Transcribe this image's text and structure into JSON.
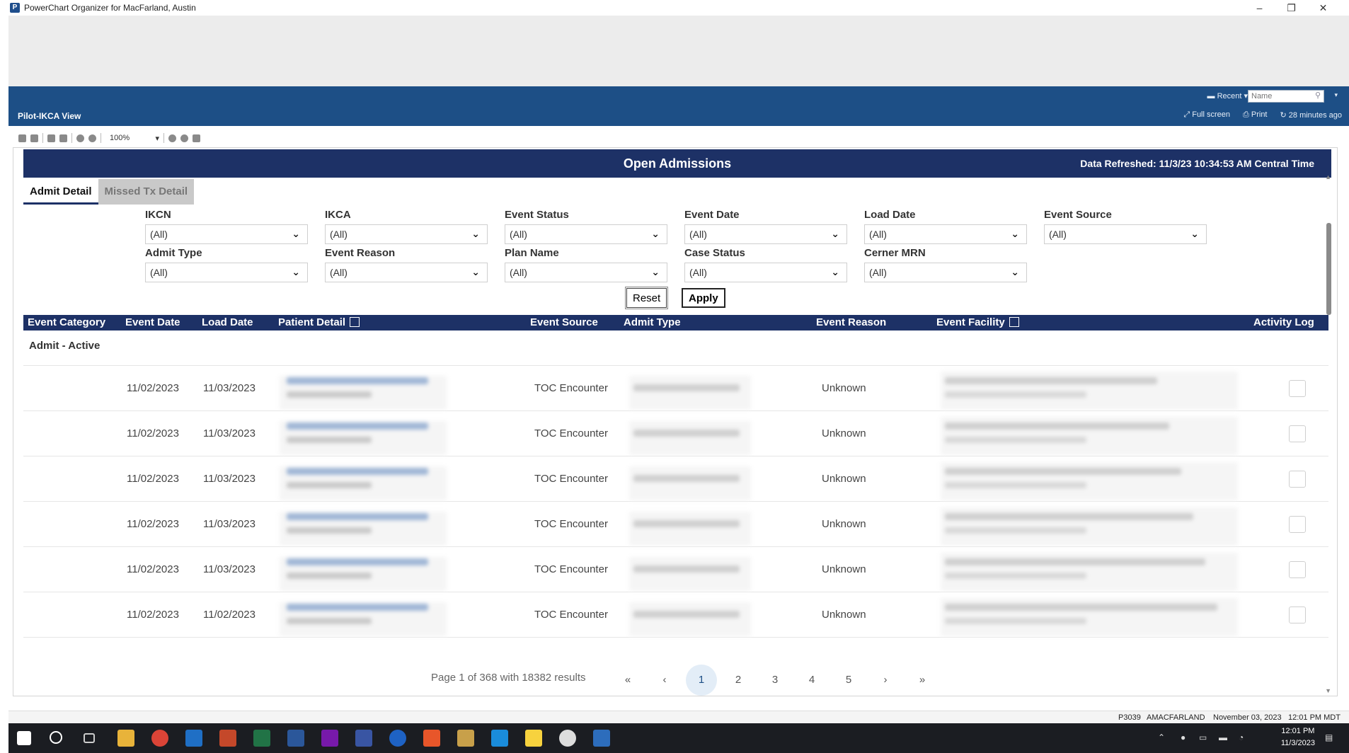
{
  "window": {
    "title": "PowerChart Organizer for MacFarland, Austin",
    "app_icon": "P",
    "controls": [
      "–",
      "❐",
      "✕"
    ]
  },
  "navbar": {
    "recent_label": "Recent",
    "name_placeholder": "Name"
  },
  "viewbar": {
    "title": "Pilot-IKCA View",
    "full_screen": "Full screen",
    "print": "Print",
    "refreshed_ago": "28 minutes ago"
  },
  "toolbar": {
    "zoom": "100%"
  },
  "header": {
    "title": "Open Admissions",
    "data_refreshed": "Data Refreshed: 11/3/23 10:34:53 AM Central Time"
  },
  "tabs": [
    {
      "label": "Admit Detail",
      "active": true
    },
    {
      "label": "Missed Tx Detail",
      "active": false
    }
  ],
  "filters": [
    {
      "label": "IKCN",
      "value": "(All)"
    },
    {
      "label": "IKCA",
      "value": "(All)"
    },
    {
      "label": "Event Status",
      "value": "(All)"
    },
    {
      "label": "Event Date",
      "value": "(All)"
    },
    {
      "label": "Load Date",
      "value": "(All)"
    },
    {
      "label": "Event Source",
      "value": "(All)"
    },
    {
      "label": "Admit Type",
      "value": "(All)"
    },
    {
      "label": "Event Reason",
      "value": "(All)"
    },
    {
      "label": "Plan Name",
      "value": "(All)"
    },
    {
      "label": "Case Status",
      "value": "(All)"
    },
    {
      "label": "Cerner MRN",
      "value": "(All)"
    }
  ],
  "buttons": {
    "reset": "Reset",
    "apply": "Apply"
  },
  "grid": {
    "columns": [
      "Event Category",
      "Event Date",
      "Load Date",
      "Patient Detail",
      "Event Source",
      "Admit Type",
      "Event Reason",
      "Event Facility",
      "Activity Log"
    ],
    "group": "Admit - Active",
    "rows": [
      {
        "event_date": "11/02/2023",
        "load_date": "11/03/2023",
        "event_source": "TOC Encounter",
        "event_reason": "Unknown"
      },
      {
        "event_date": "11/02/2023",
        "load_date": "11/03/2023",
        "event_source": "TOC Encounter",
        "event_reason": "Unknown"
      },
      {
        "event_date": "11/02/2023",
        "load_date": "11/03/2023",
        "event_source": "TOC Encounter",
        "event_reason": "Unknown"
      },
      {
        "event_date": "11/02/2023",
        "load_date": "11/03/2023",
        "event_source": "TOC Encounter",
        "event_reason": "Unknown"
      },
      {
        "event_date": "11/02/2023",
        "load_date": "11/03/2023",
        "event_source": "TOC Encounter",
        "event_reason": "Unknown"
      },
      {
        "event_date": "11/02/2023",
        "load_date": "11/02/2023",
        "event_source": "TOC Encounter",
        "event_reason": "Unknown"
      }
    ]
  },
  "pager": {
    "info": "Page 1 of 368 with 18382 results",
    "first": "«",
    "prev": "‹",
    "pages": [
      "1",
      "2",
      "3",
      "4",
      "5"
    ],
    "current": "1",
    "next": "›",
    "last": "»"
  },
  "statusbar": {
    "code": "P3039",
    "user": "AMACFARLAND",
    "date": "November 03, 2023",
    "time": "12:01 PM MDT"
  },
  "taskbar": {
    "clock_time": "12:01 PM",
    "clock_date": "11/3/2023"
  }
}
